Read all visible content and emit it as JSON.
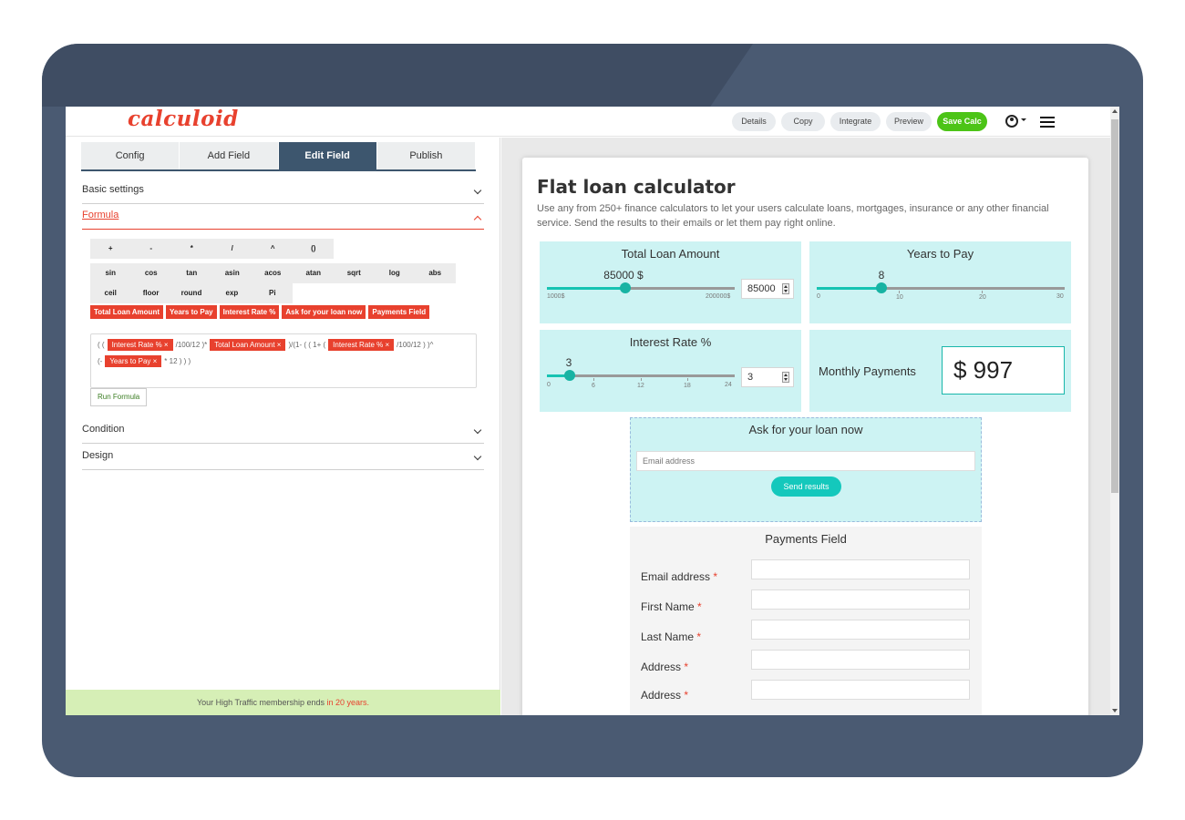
{
  "app": {
    "logo": "calculoid"
  },
  "topbar": {
    "buttons": [
      "Details",
      "Copy",
      "Integrate",
      "Preview",
      "Save Calc"
    ]
  },
  "editor": {
    "tabs": [
      "Config",
      "Add Field",
      "Edit Field",
      "Publish"
    ],
    "active_tab": "Edit Field",
    "sections": {
      "basic": "Basic settings",
      "formula": "Formula",
      "condition": "Condition",
      "design": "Design"
    },
    "operators_row1": [
      "+",
      "-",
      "*",
      "/",
      "^",
      "()"
    ],
    "functions_row2": [
      "sin",
      "cos",
      "tan",
      "asin",
      "acos",
      "atan",
      "sqrt",
      "log",
      "abs"
    ],
    "functions_row3": [
      "ceil",
      "floor",
      "round",
      "exp",
      "Pi"
    ],
    "field_tags": [
      "Total Loan Amount",
      "Years to Pay",
      "Interest Rate %",
      "Ask for your loan now",
      "Payments Field"
    ],
    "formula": {
      "t1": "( (",
      "chip1": "Interest Rate % ×",
      "t2": "/100/12 )*",
      "chip2": "Total Loan Amount ×",
      "t3": ")/(1- ( ( 1+ (",
      "chip3": "Interest Rate % ×",
      "t4": "/100/12 ) )^",
      "t5": "(-",
      "chip4": "Years to Pay ×",
      "t6": "* 12 ) ) )"
    },
    "run_button": "Run Formula",
    "banner_text": "Your High Traffic membership ends",
    "banner_highlight": "in 20 years."
  },
  "calculator": {
    "title": "Flat loan calculator",
    "description": "Use any from 250+ finance calculators to let your users calculate loans, mortgages, insurance or any other financial service. Send the results to their emails or let them pay right online.",
    "loan": {
      "title": "Total Loan Amount",
      "value_label": "85000 $",
      "min_label": "1000$",
      "max_label": "200000$",
      "input_value": "85000",
      "fraction": 0.42
    },
    "years": {
      "title": "Years to Pay",
      "value_label": "8",
      "ticks": [
        "0",
        "10",
        "20",
        "30"
      ],
      "fraction": 0.267
    },
    "rate": {
      "title": "Interest Rate %",
      "value_label": "3",
      "ticks": [
        "0",
        "6",
        "12",
        "18",
        "24"
      ],
      "input_value": "3",
      "fraction": 0.125
    },
    "payments": {
      "label": "Monthly Payments",
      "value": "$ 997"
    },
    "ask": {
      "title": "Ask for your loan now",
      "email_placeholder": "Email address",
      "send_label": "Send results"
    },
    "payments_field": {
      "title": "Payments Field",
      "rows": [
        "Email address",
        "First Name",
        "Last Name",
        "Address",
        "Address"
      ],
      "required_mark": "*"
    }
  },
  "colors": {
    "accent": "#e8412e",
    "teal": "#17b3a3",
    "panel": "#cdf3f3",
    "tab_active": "#3d566e",
    "save": "#4cc417"
  }
}
